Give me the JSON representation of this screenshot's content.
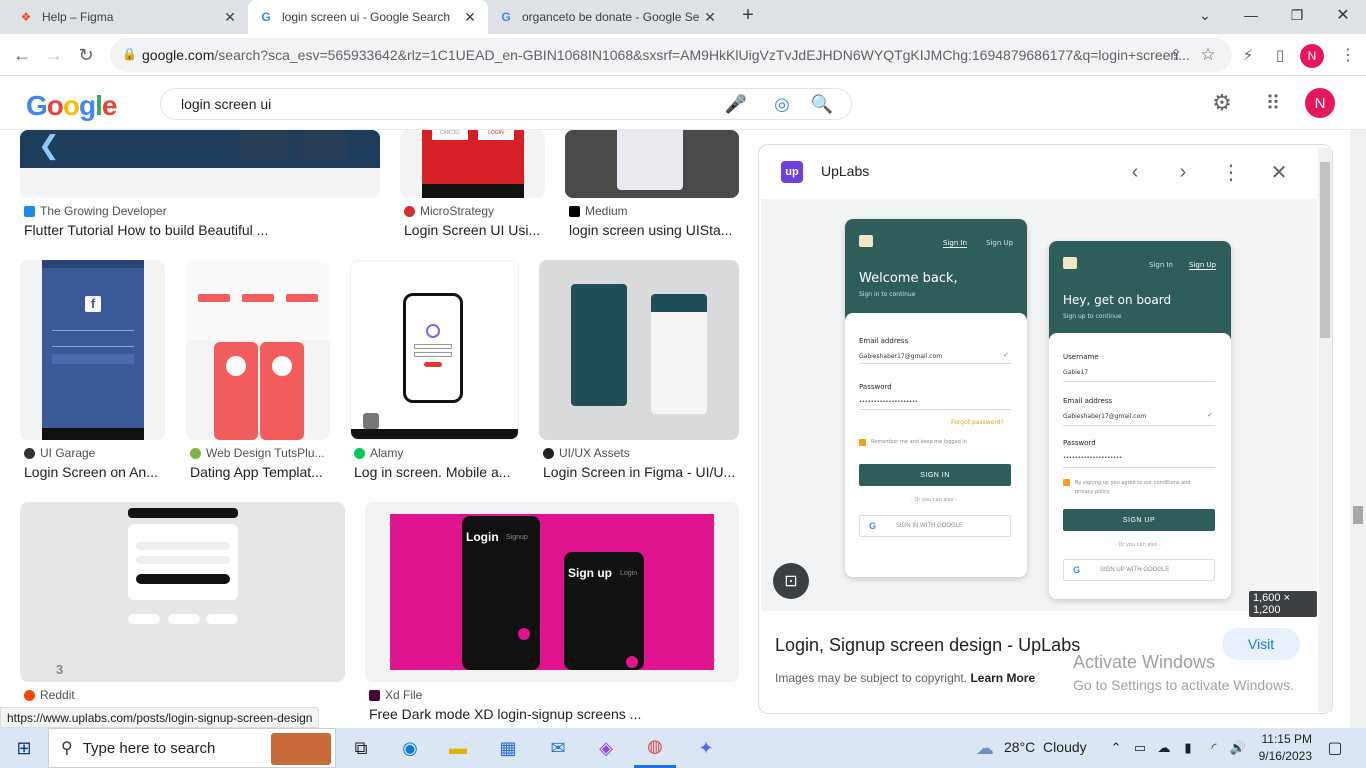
{
  "browser": {
    "tabs": [
      {
        "title": "Help – Figma",
        "icon": "figma-icon",
        "active": false
      },
      {
        "title": "login screen ui - Google Search",
        "icon": "google-icon",
        "active": true
      },
      {
        "title": "organceto be donate - Google Se",
        "icon": "google-icon",
        "active": false
      }
    ],
    "new_tab": "+",
    "url_main": "google.com",
    "url_rest": "/search?sca_esv=565933642&rlz=1C1UEAD_en-GBIN1068IN1068&sxsrf=AM9HkKlUigVzTvJdEJHDN6WYQTgKIJMChg:1694879686177&q=login+screen...",
    "profile_initial": "N"
  },
  "google": {
    "logo": "Google",
    "query": "login screen ui",
    "account_initial": "N"
  },
  "results": [
    {
      "source": "The Growing Developer",
      "caption": "Flutter Tutorial How to build Beautiful ...",
      "color": "#1e88e5"
    },
    {
      "source": "MicroStrategy",
      "caption": "Login Screen UI Usi...",
      "color": "#d32f2f"
    },
    {
      "source": "Medium",
      "caption": "login screen using UISta...",
      "color": "#000000"
    },
    {
      "source": "UI Garage",
      "caption": "Login Screen on An...",
      "color": "#333333"
    },
    {
      "source": "Web Design TutsPlu...",
      "caption": "Dating App Templat...",
      "color": "#7cb342"
    },
    {
      "source": "Alamy",
      "caption": "Log in screen. Mobile a...",
      "color": "#00c853"
    },
    {
      "source": "UI/UX Assets",
      "caption": "Login Screen in Figma - UI/U...",
      "color": "#222222"
    },
    {
      "source": "Reddit",
      "caption": "",
      "color": "#ff4500"
    },
    {
      "source": "Xd File",
      "caption": "Free Dark mode XD login-signup screens ...",
      "color": "#470137"
    }
  ],
  "thumb_text": {
    "r1c2_left": "CANCEL",
    "r1c2_right": "LOGIN",
    "reddit_badge": "3",
    "xd_login": "Login",
    "xd_signup_tab": "Signup",
    "xd_signup": "Sign up",
    "xd_login_tab": "Login"
  },
  "panel": {
    "site": "UpLabs",
    "site_logo": "up",
    "title": "Login, Signup screen design - UpLabs",
    "visit": "Visit",
    "dimensions": "1,600 × 1,200",
    "notice": "Images may be subject to copyright.",
    "learn_more": "Learn More",
    "left_card": {
      "tab_signin": "Sign In",
      "tab_signup": "Sign Up",
      "heading": "Welcome back,",
      "sub": "Sign in to continue",
      "email_label": "Email address",
      "email_value": "Gabieshaber17@gmail.com",
      "password_label": "Password",
      "password_value": "••••••••••••••••••••",
      "forgot": "Forgot password?",
      "remember": "Remember me and keep me logged in",
      "button": "SIGN IN",
      "or": "- Or you can also -",
      "google": "SIGN IN WITH GOOGLE"
    },
    "right_card": {
      "tab_signin": "Sign In",
      "tab_signup": "Sign Up",
      "heading": "Hey, get on board",
      "sub": "Sign up to continue",
      "username_label": "Username",
      "username_value": "Gabie17",
      "email_label": "Email address",
      "email_value": "Gabieshaber17@gmail.com",
      "password_label": "Password",
      "password_value": "••••••••••••••••••••",
      "agree": "By signing up you agree to our conditions and privacy policy",
      "button": "SIGN UP",
      "or": "- Or you can also -",
      "google": "SIGN UP WITH GOOGLE"
    }
  },
  "watermark": {
    "line1": "Activate Windows",
    "line2": "Go to Settings to activate Windows."
  },
  "status_url": "https://www.uplabs.com/posts/login-signup-screen-design",
  "taskbar": {
    "search_placeholder": "Type here to search",
    "weather": "28°C  Cloudy",
    "time": "11:15 PM",
    "date": "9/16/2023"
  }
}
